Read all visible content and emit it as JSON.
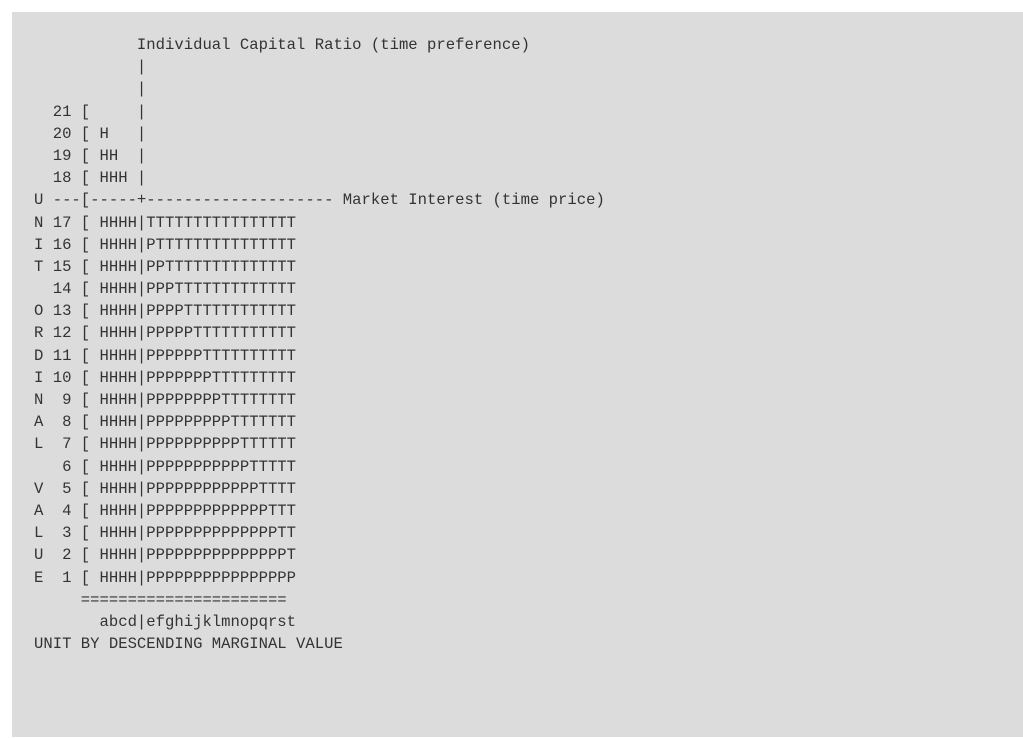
{
  "diagram": {
    "lines": [
      "           Individual Capital Ratio (time preference)",
      "           |",
      "           |",
      "  21 [     |",
      "  20 [ H   |",
      "  19 [ HH  |",
      "  18 [ HHH |",
      "U ---[-----+-------------------- Market Interest (time price)",
      "N 17 [ HHHH|TTTTTTTTTTTTTTTT",
      "I 16 [ HHHH|PTTTTTTTTTTTTTTT",
      "T 15 [ HHHH|PPTTTTTTTTTTTTTT",
      "  14 [ HHHH|PPPTTTTTTTTTTTTT",
      "O 13 [ HHHH|PPPPTTTTTTTTTTTT",
      "R 12 [ HHHH|PPPPPTTTTTTTTTTT",
      "D 11 [ HHHH|PPPPPPTTTTTTTTTT",
      "I 10 [ HHHH|PPPPPPPTTTTTTTTT",
      "N  9 [ HHHH|PPPPPPPPTTTTTTTT",
      "A  8 [ HHHH|PPPPPPPPPTTTTTTT",
      "L  7 [ HHHH|PPPPPPPPPPTTTTTT",
      "   6 [ HHHH|PPPPPPPPPPPTTTTT",
      "V  5 [ HHHH|PPPPPPPPPPPPTTTT",
      "A  4 [ HHHH|PPPPPPPPPPPPPTTT",
      "L  3 [ HHHH|PPPPPPPPPPPPPPTT",
      "U  2 [ HHHH|PPPPPPPPPPPPPPPT",
      "E  1 [ HHHH|PPPPPPPPPPPPPPPP",
      "     ======================",
      "       abcd|efghijklmnopqrst",
      "UNIT BY DESCENDING MARGINAL VALUE"
    ]
  }
}
